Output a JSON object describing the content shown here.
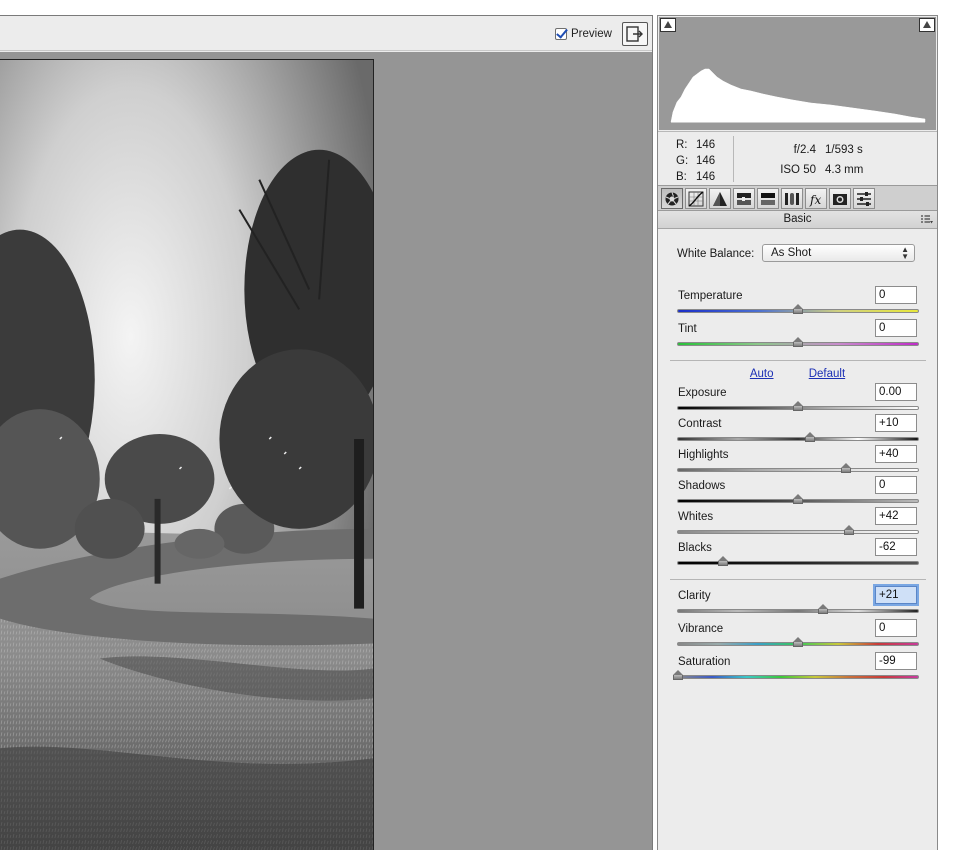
{
  "toolbar": {
    "preview_label": "Preview",
    "preview_checked": true
  },
  "info": {
    "rgb": [
      {
        "key": "R:",
        "value": "146"
      },
      {
        "key": "G:",
        "value": "146"
      },
      {
        "key": "B:",
        "value": "146"
      }
    ],
    "aperture": "f/2.4",
    "shutter": "1/593 s",
    "iso": "ISO 50",
    "focal": "4.3 mm"
  },
  "tabs": [
    {
      "name": "basic-tab",
      "icon": "aperture-icon",
      "active": true
    },
    {
      "name": "tone-curve-tab",
      "icon": "curve-icon"
    },
    {
      "name": "detail-tab",
      "icon": "triangle-icon"
    },
    {
      "name": "hsl-tab",
      "icon": "hsl-icon"
    },
    {
      "name": "split-toning-tab",
      "icon": "split-tone-icon"
    },
    {
      "name": "lens-corrections-tab",
      "icon": "lens-icon"
    },
    {
      "name": "effects-tab",
      "icon": "fx-icon"
    },
    {
      "name": "camera-calibration-tab",
      "icon": "camera-icon"
    },
    {
      "name": "presets-tab",
      "icon": "sliders-icon"
    }
  ],
  "panel_title": "Basic",
  "white_balance": {
    "label": "White Balance:",
    "value": "As Shot"
  },
  "links": {
    "auto": "Auto",
    "default": "Default"
  },
  "sliders": {
    "temperature": {
      "label": "Temperature",
      "value": "0",
      "position": 0.5
    },
    "tint": {
      "label": "Tint",
      "value": "0",
      "position": 0.5
    },
    "exposure": {
      "label": "Exposure",
      "value": "0.00",
      "position": 0.5
    },
    "contrast": {
      "label": "Contrast",
      "value": "+10",
      "position": 0.55
    },
    "highlights": {
      "label": "Highlights",
      "value": "+40",
      "position": 0.7
    },
    "shadows": {
      "label": "Shadows",
      "value": "0",
      "position": 0.5
    },
    "whites": {
      "label": "Whites",
      "value": "+42",
      "position": 0.71
    },
    "blacks": {
      "label": "Blacks",
      "value": "-62",
      "position": 0.19
    },
    "clarity": {
      "label": "Clarity",
      "value": "+21",
      "position": 0.605
    },
    "vibrance": {
      "label": "Vibrance",
      "value": "0",
      "position": 0.5
    },
    "saturation": {
      "label": "Saturation",
      "value": "-99",
      "position": 0.005
    }
  }
}
